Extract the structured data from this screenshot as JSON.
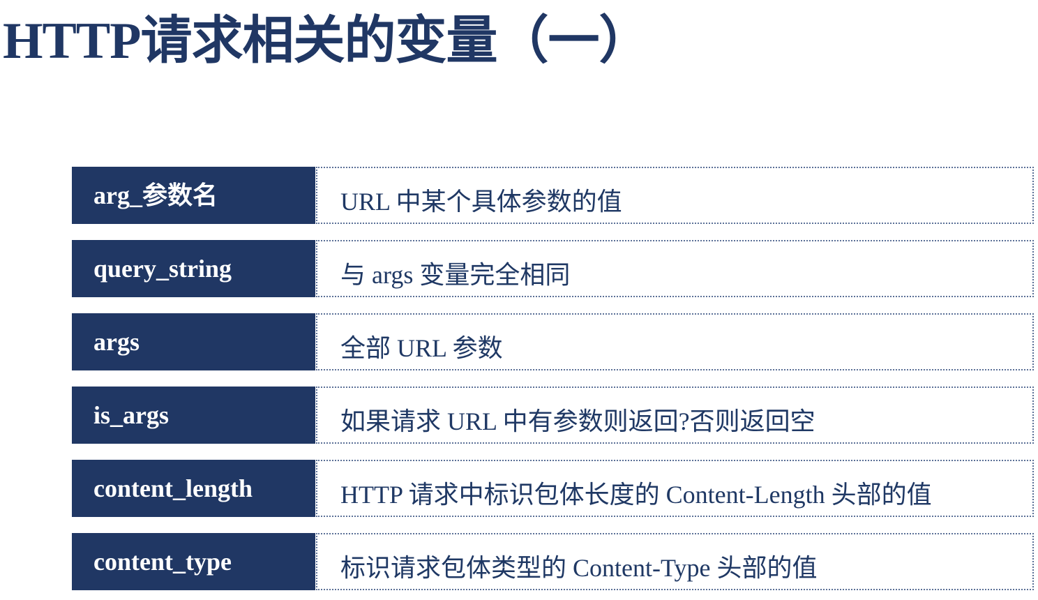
{
  "title": "HTTP请求相关的变量（一）",
  "rows": [
    {
      "name": "arg_参数名",
      "desc": "URL 中某个具体参数的值"
    },
    {
      "name": "query_string",
      "desc": "与 args 变量完全相同"
    },
    {
      "name": "args",
      "desc": "全部 URL 参数"
    },
    {
      "name": "is_args",
      "desc": "如果请求 URL 中有参数则返回?否则返回空"
    },
    {
      "name": "content_length",
      "desc": "HTTP 请求中标识包体长度的 Content-Length 头部的值"
    },
    {
      "name": "content_type",
      "desc": "标识请求包体类型的 Content-Type 头部的值"
    }
  ],
  "colors": {
    "accent": "#203764",
    "text": "#1f3864",
    "border": "#5a6f96"
  }
}
